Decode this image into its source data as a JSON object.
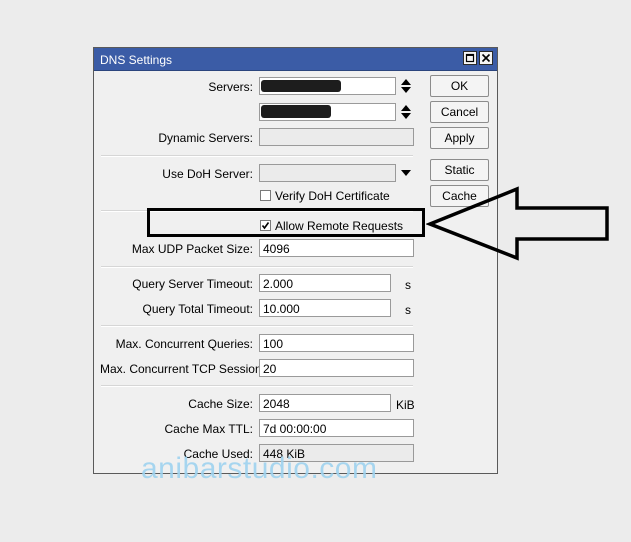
{
  "window": {
    "title": "DNS Settings",
    "controls": [
      "restore-icon",
      "close-icon"
    ]
  },
  "form": {
    "servers_label": "Servers:",
    "server_1_value": "",
    "server_2_value": "",
    "dynamic_servers_label": "Dynamic Servers:",
    "dynamic_servers_value": "",
    "use_doh_label": "Use DoH Server:",
    "use_doh_value": "",
    "verify_doh_label": "Verify DoH Certificate",
    "verify_doh_checked": false,
    "allow_remote_label": "Allow Remote Requests",
    "allow_remote_checked": true,
    "max_udp_label": "Max UDP Packet Size:",
    "max_udp_value": "4096",
    "query_server_timeout_label": "Query Server Timeout:",
    "query_server_timeout_value": "2.000",
    "query_server_timeout_unit": "s",
    "query_total_timeout_label": "Query Total Timeout:",
    "query_total_timeout_value": "10.000",
    "query_total_timeout_unit": "s",
    "max_concurrent_queries_label": "Max. Concurrent Queries:",
    "max_concurrent_queries_value": "100",
    "max_concurrent_tcp_label": "Max. Concurrent TCP Sessions:",
    "max_concurrent_tcp_value": "20",
    "cache_size_label": "Cache Size:",
    "cache_size_value": "2048",
    "cache_size_unit": "KiB",
    "cache_max_ttl_label": "Cache Max TTL:",
    "cache_max_ttl_value": "7d 00:00:00",
    "cache_used_label": "Cache Used:",
    "cache_used_value": "448 KiB"
  },
  "buttons": {
    "ok": "OK",
    "cancel": "Cancel",
    "apply": "Apply",
    "static": "Static",
    "cache": "Cache"
  },
  "watermark": "anibarstudio.com",
  "colors": {
    "titlebar": "#3b5ca6",
    "annotation": "#000000",
    "watermark": "#9fd3ef"
  }
}
